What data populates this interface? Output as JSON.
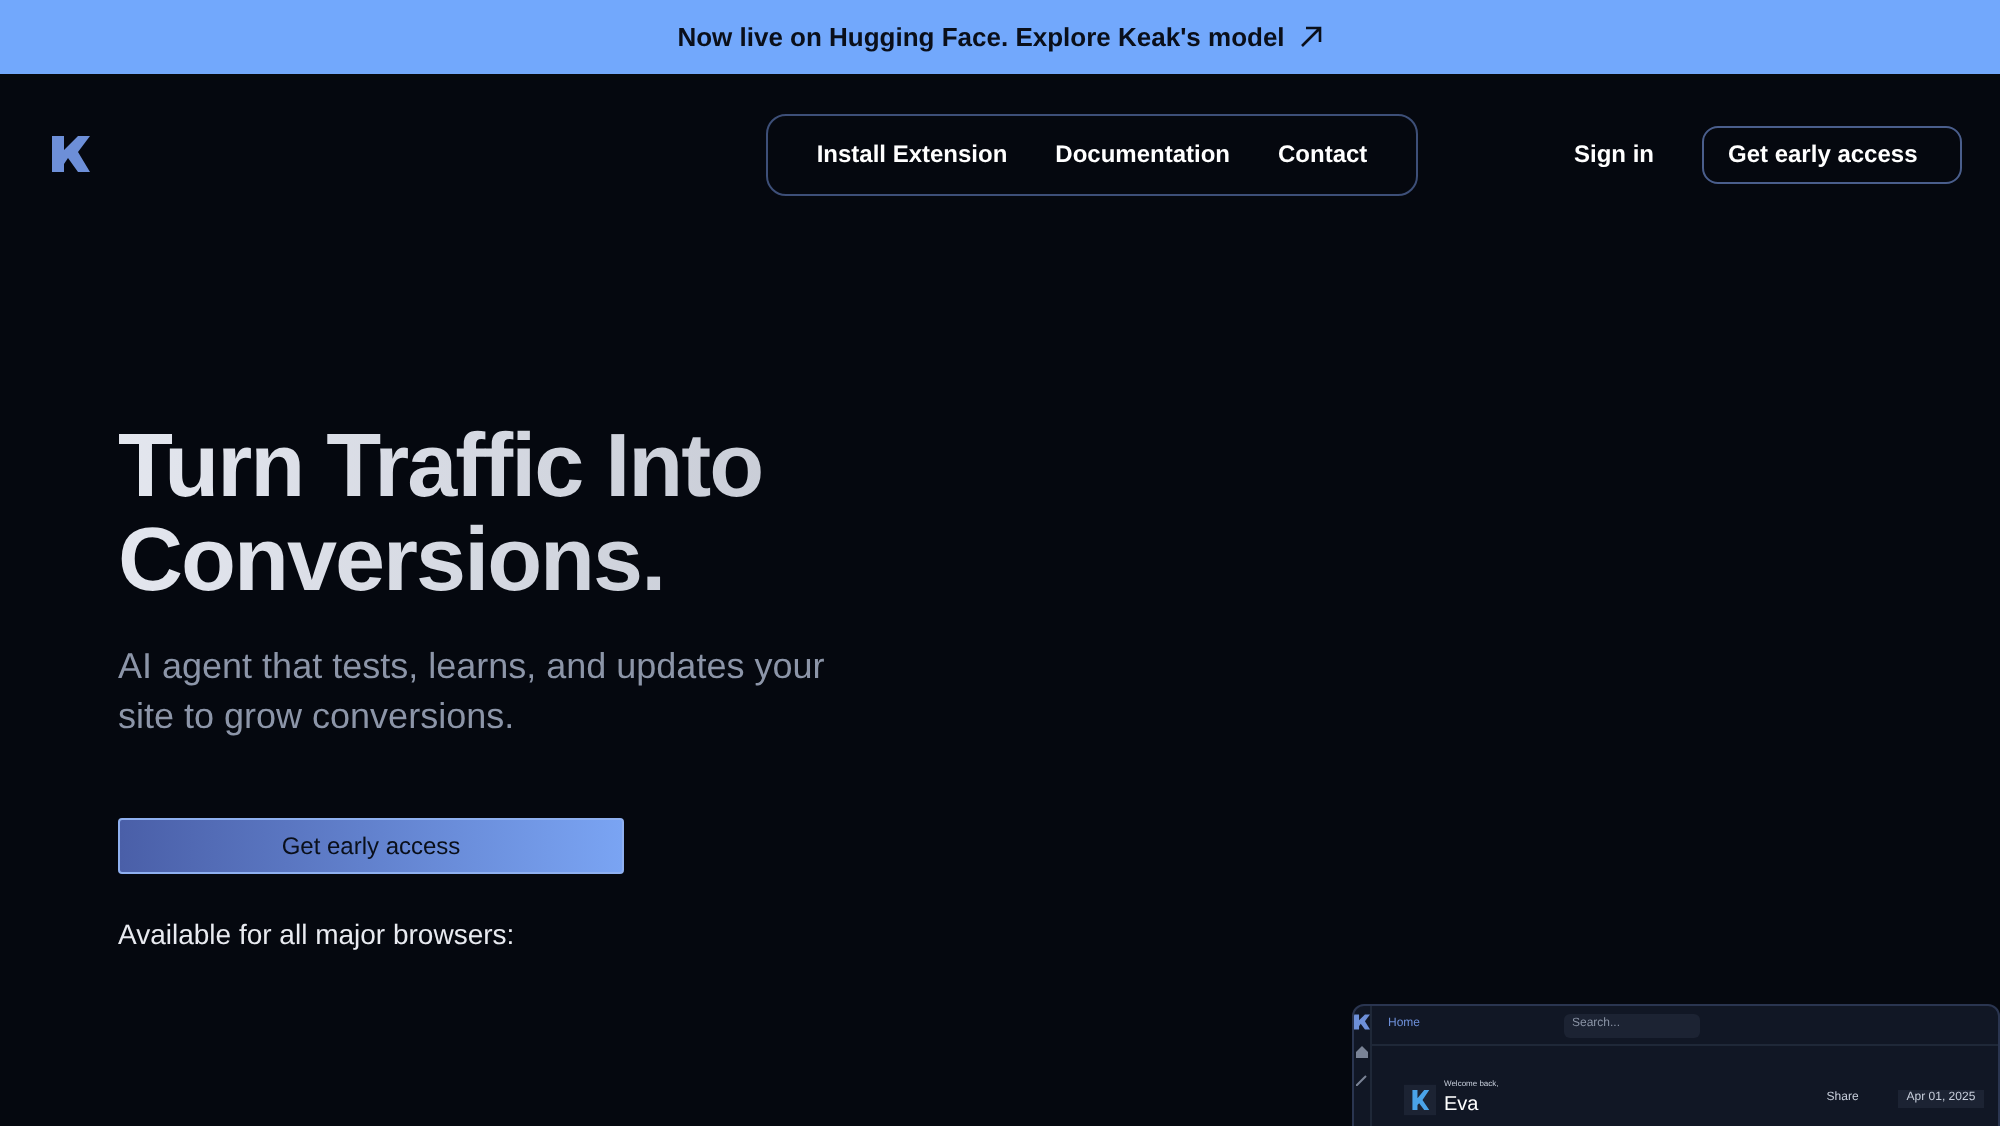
{
  "banner": {
    "text": "Now live on Hugging Face. Explore Keak's model"
  },
  "nav": {
    "links": [
      "Install Extension",
      "Documentation",
      "Contact"
    ],
    "sign_in": "Sign in",
    "cta": "Get early access"
  },
  "hero": {
    "title_lines": [
      "Turn Traffic Into",
      "Conversions."
    ],
    "subtitle": "AI agent that tests, learns, and updates your site to grow conversions.",
    "cta": "Get early access",
    "browsers_label": "Available for all major browsers:"
  },
  "preview": {
    "breadcrumb": "Home",
    "search_placeholder": "Search...",
    "welcome": "Welcome back,",
    "user": "Eva",
    "share": "Share",
    "date": "Apr 01, 2025"
  }
}
